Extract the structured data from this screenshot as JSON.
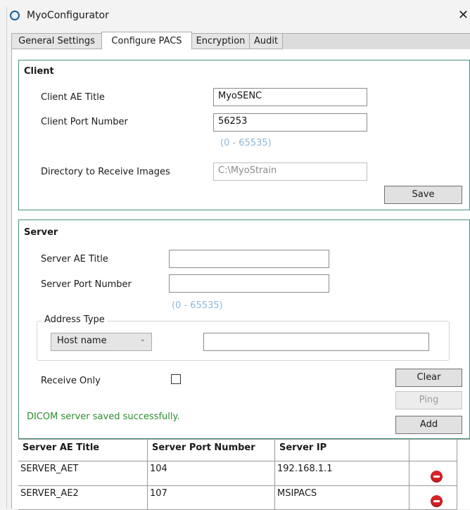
{
  "window": {
    "title": "MyoConfigurator",
    "close_glyph": "✕"
  },
  "tabs": [
    {
      "label": "General Settings"
    },
    {
      "label": "Configure PACS"
    },
    {
      "label": "Encryption"
    },
    {
      "label": "Audit"
    }
  ],
  "client": {
    "heading": "Client",
    "ae_title_label": "Client AE Title",
    "ae_title_value": "MyoSENC",
    "port_label": "Client Port Number",
    "port_value": "56253",
    "port_range_hint": "(0 - 65535)",
    "directory_label": "Directory to Receive Images",
    "directory_value": "C:\\MyoStrain",
    "save_label": "Save"
  },
  "server": {
    "heading": "Server",
    "ae_title_label": "Server AE Title",
    "ae_title_value": "",
    "port_label": "Server Port Number",
    "port_value": "",
    "port_range_hint": "(0 - 65535)",
    "address_type_legend": "Address Type",
    "address_type_selected": "Host name",
    "address_value": "",
    "receive_only_label": "Receive Only",
    "receive_only_checked": false,
    "clear_label": "Clear",
    "ping_label": "Ping",
    "add_label": "Add",
    "status_message": "DICOM server saved successfully.",
    "status_color": "#2e8b2e"
  },
  "server_table": {
    "columns": [
      "Server AE Title",
      "Server Port Number",
      "Server IP",
      ""
    ],
    "rows": [
      {
        "ae_title": "SERVER_AET",
        "port": "104",
        "ip": "192.168.1.1"
      },
      {
        "ae_title": "SERVER_AE2",
        "port": "107",
        "ip": "MSIPACS"
      }
    ],
    "delete_icon": "delete-circle-icon",
    "delete_icon_color": "#d9232a"
  },
  "colors": {
    "group_border": "#4a8f7f",
    "hint": "#8fb6d6"
  }
}
